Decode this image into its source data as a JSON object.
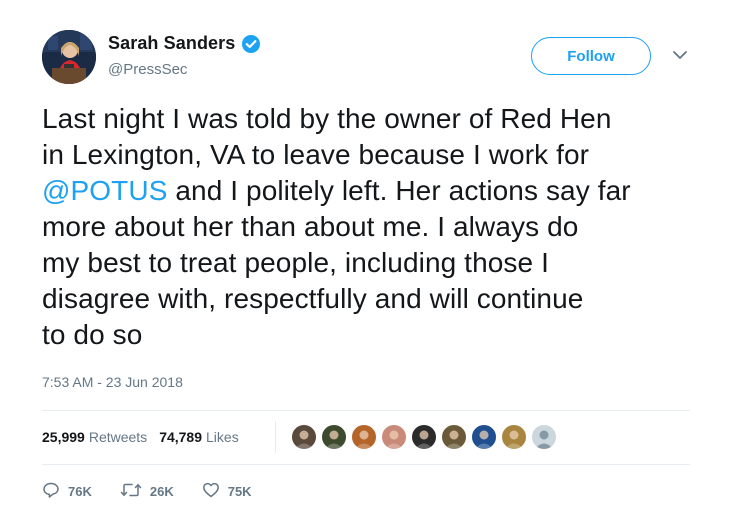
{
  "author": {
    "display_name": "Sarah Sanders",
    "handle": "@PressSec",
    "verified": true,
    "avatar_icon": "profile-photo"
  },
  "follow_label": "Follow",
  "tweet": {
    "lines": [
      {
        "text": "Last night I was told by the owner of Red Hen"
      },
      {
        "text": "in Lexington, VA to leave because I work for"
      },
      {
        "mention": "@POTUS",
        "text": " and I politely left. Her actions say far"
      },
      {
        "text": "more about her than about me. I always do"
      },
      {
        "text": "my best to treat people, including those I"
      },
      {
        "text": "disagree with, respectfully and will continue"
      },
      {
        "text": "to do so"
      }
    ]
  },
  "timestamp": "7:53 AM - 23 Jun 2018",
  "stats": {
    "retweets_count": "25,999",
    "retweets_label": "Retweets",
    "likes_count": "74,789",
    "likes_label": "Likes"
  },
  "likers": [
    "#5a4a3c",
    "#3d4a2e",
    "#b5652a",
    "#c98a7a",
    "#2b2b2b",
    "#6b5a3a",
    "#1f4f8f",
    "#a9863f",
    "#ccd6dd"
  ],
  "actions": {
    "reply_count": "76K",
    "retweet_count": "26K",
    "like_count": "75K"
  },
  "colors": {
    "accent": "#1da1f2",
    "secondary_text": "#657786",
    "divider": "#e6ecf0"
  }
}
